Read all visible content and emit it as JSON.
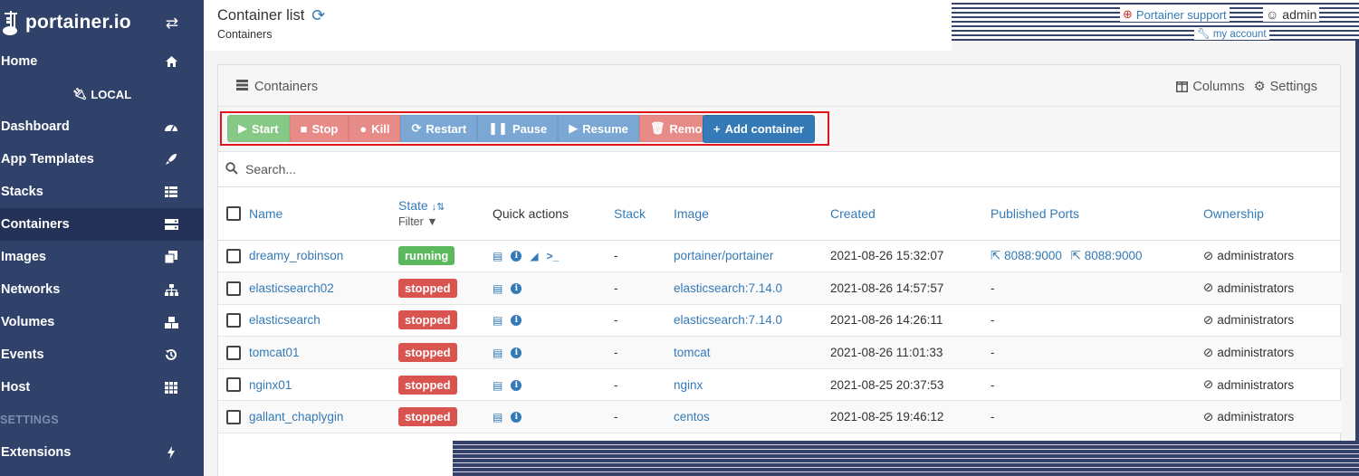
{
  "brand": {
    "name": "portainer.io"
  },
  "sidebar": {
    "endpoint": "LOCAL",
    "items": [
      {
        "label": "Home"
      },
      {
        "label": "Dashboard"
      },
      {
        "label": "App Templates"
      },
      {
        "label": "Stacks"
      },
      {
        "label": "Containers"
      },
      {
        "label": "Images"
      },
      {
        "label": "Networks"
      },
      {
        "label": "Volumes"
      },
      {
        "label": "Events"
      },
      {
        "label": "Host"
      }
    ],
    "settings_heading": "SETTINGS",
    "extensions": "Extensions"
  },
  "header": {
    "title": "Container list",
    "breadcrumb": "Containers",
    "support": "Portainer support",
    "user": "admin",
    "account": "my account"
  },
  "panel": {
    "title": "Containers",
    "columns_label": "Columns",
    "settings_label": "Settings"
  },
  "actions": {
    "start": "Start",
    "stop": "Stop",
    "kill": "Kill",
    "restart": "Restart",
    "pause": "Pause",
    "resume": "Resume",
    "remove": "Remove",
    "add": "Add container"
  },
  "search": {
    "placeholder": "Search..."
  },
  "table": {
    "headers": {
      "name": "Name",
      "state": "State",
      "filter": "Filter",
      "quick_actions": "Quick actions",
      "stack": "Stack",
      "image": "Image",
      "created": "Created",
      "ports": "Published Ports",
      "ownership": "Ownership"
    },
    "rows": [
      {
        "name": "dreamy_robinson",
        "state": "running",
        "stack": "-",
        "image": "portainer/portainer",
        "created": "2021-08-26 15:32:07",
        "ports": [
          "8088:9000",
          "8088:9000"
        ],
        "ownership": "administrators"
      },
      {
        "name": "elasticsearch02",
        "state": "stopped",
        "stack": "-",
        "image": "elasticsearch:7.14.0",
        "created": "2021-08-26 14:57:57",
        "ports_text": "-",
        "ownership": "administrators"
      },
      {
        "name": "elasticsearch",
        "state": "stopped",
        "stack": "-",
        "image": "elasticsearch:7.14.0",
        "created": "2021-08-26 14:26:11",
        "ports_text": "-",
        "ownership": "administrators"
      },
      {
        "name": "tomcat01",
        "state": "stopped",
        "stack": "-",
        "image": "tomcat",
        "created": "2021-08-26 11:01:33",
        "ports_text": "-",
        "ownership": "administrators"
      },
      {
        "name": "nginx01",
        "state": "stopped",
        "stack": "-",
        "image": "nginx",
        "created": "2021-08-25 20:37:53",
        "ports_text": "-",
        "ownership": "administrators"
      },
      {
        "name": "gallant_chaplygin",
        "state": "stopped",
        "stack": "-",
        "image": "centos",
        "created": "2021-08-25 19:46:12",
        "ports_text": "-",
        "ownership": "administrators"
      }
    ]
  },
  "colors": {
    "sidebar": "#30426a",
    "sidebar_active": "#243258",
    "link": "#337ab7",
    "running": "#5cb85c",
    "stopped": "#d9534f",
    "highlight": "#e0141b"
  }
}
